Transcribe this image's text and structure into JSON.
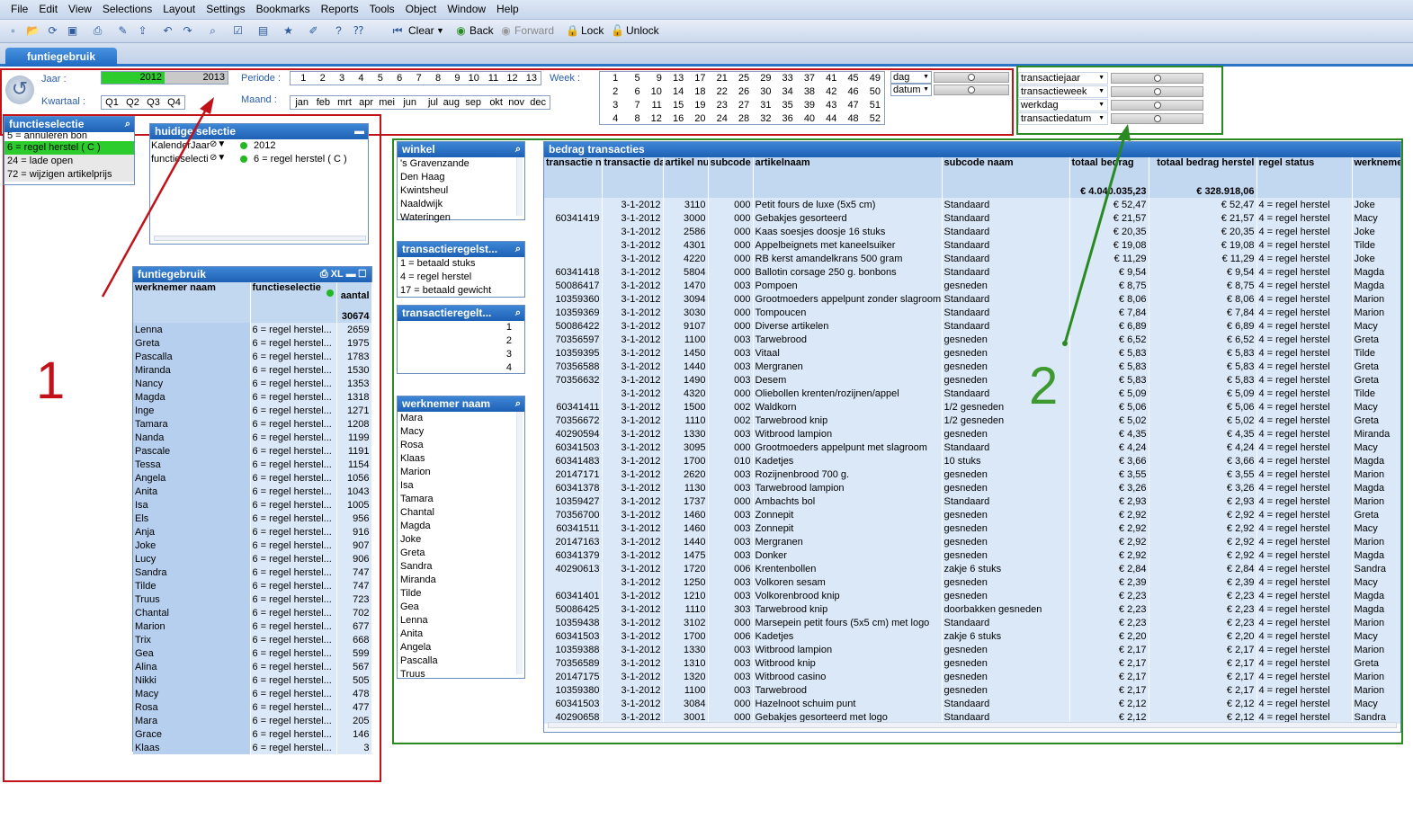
{
  "menu": [
    "File",
    "Edit",
    "View",
    "Selections",
    "Layout",
    "Settings",
    "Bookmarks",
    "Reports",
    "Tools",
    "Object",
    "Window",
    "Help"
  ],
  "toolbar": {
    "clear": "Clear",
    "back": "Back",
    "forward": "Forward",
    "lock": "Lock",
    "unlock": "Unlock"
  },
  "tab": "funtiegebruik",
  "filters": {
    "jaar_label": "Jaar :",
    "jaar": [
      "2012",
      "2013"
    ],
    "kwartaal_label": "Kwartaal :",
    "kwartaal": [
      "Q1",
      "Q2",
      "Q3",
      "Q4"
    ],
    "periode_label": "Periode :",
    "periode": [
      "1",
      "2",
      "3",
      "4",
      "5",
      "6",
      "7",
      "8",
      "9",
      "10",
      "11",
      "12",
      "13"
    ],
    "maand_label": "Maand :",
    "maand": [
      "jan",
      "feb",
      "mrt",
      "apr",
      "mei",
      "jun",
      "jul",
      "aug",
      "sep",
      "okt",
      "nov",
      "dec"
    ],
    "week_label": "Week :",
    "weeks": [
      "1",
      "5",
      "9",
      "13",
      "17",
      "21",
      "25",
      "29",
      "33",
      "37",
      "41",
      "45",
      "49",
      "2",
      "6",
      "10",
      "14",
      "18",
      "22",
      "26",
      "30",
      "34",
      "38",
      "42",
      "46",
      "50",
      "3",
      "7",
      "11",
      "15",
      "19",
      "23",
      "27",
      "31",
      "35",
      "39",
      "43",
      "47",
      "51",
      "4",
      "8",
      "12",
      "16",
      "20",
      "24",
      "28",
      "32",
      "36",
      "40",
      "44",
      "48",
      "52"
    ],
    "dag": "dag",
    "datum": "datum",
    "right": [
      "transactiejaar",
      "transactieweek",
      "werkdag",
      "transactiedatum"
    ]
  },
  "functieselectie": {
    "title": "functieselectie",
    "items": [
      "5 = annuleren bon",
      "6 = regel herstel ( C )",
      "24 = lade open",
      "72 = wijzigen artikelprijs"
    ]
  },
  "huidige": {
    "title": "huidige selectie",
    "rows": [
      {
        "field": "KalenderJaar",
        "value": "2012"
      },
      {
        "field": "functieselectie",
        "value": "6 = regel herstel ( C )"
      }
    ]
  },
  "funtiegebruik": {
    "title": "funtiegebruik",
    "h1": "werknemer naam",
    "h2": "functieselectie",
    "h3": "aantal",
    "total": "30674",
    "rows": [
      [
        "Lenna",
        "2659"
      ],
      [
        "Greta",
        "1975"
      ],
      [
        "Pascalla",
        "1783"
      ],
      [
        "Miranda",
        "1530"
      ],
      [
        "Nancy",
        "1353"
      ],
      [
        "Magda",
        "1318"
      ],
      [
        "Inge",
        "1271"
      ],
      [
        "Tamara",
        "1208"
      ],
      [
        "Nanda",
        "1199"
      ],
      [
        "Pascale",
        "1191"
      ],
      [
        "Tessa",
        "1154"
      ],
      [
        "Angela",
        "1056"
      ],
      [
        "Anita",
        "1043"
      ],
      [
        "Isa",
        "1005"
      ],
      [
        "Els",
        "956"
      ],
      [
        "Anja",
        "916"
      ],
      [
        "Joke",
        "907"
      ],
      [
        "Lucy",
        "906"
      ],
      [
        "Sandra",
        "747"
      ],
      [
        "Tilde",
        "747"
      ],
      [
        "Truus",
        "723"
      ],
      [
        "Chantal",
        "702"
      ],
      [
        "Marion",
        "677"
      ],
      [
        "Trix",
        "668"
      ],
      [
        "Gea",
        "599"
      ],
      [
        "Alina",
        "567"
      ],
      [
        "Nikki",
        "505"
      ],
      [
        "Macy",
        "478"
      ],
      [
        "Rosa",
        "477"
      ],
      [
        "Mara",
        "205"
      ],
      [
        "Grace",
        "146"
      ],
      [
        "Klaas",
        "3"
      ]
    ],
    "func": "6 = regel herstel..."
  },
  "winkel": {
    "title": "winkel",
    "items": [
      "'s Gravenzande",
      "Den Haag",
      "Kwintsheul",
      "Naaldwijk",
      "Wateringen"
    ]
  },
  "tr1": {
    "title": "transactieregelst...",
    "items": [
      "1 = betaald stuks",
      "4 = regel herstel",
      "17 = betaald gewicht"
    ]
  },
  "tr2": {
    "title": "transactieregelt...",
    "items": [
      "1",
      "2",
      "3",
      "4"
    ]
  },
  "werknemer": {
    "title": "werknemer naam",
    "items": [
      "Mara",
      "Macy",
      "Rosa",
      "Klaas",
      "Marion",
      "Isa",
      "Tamara",
      "Chantal",
      "Magda",
      "Joke",
      "Greta",
      "Sandra",
      "Miranda",
      "Tilde",
      "Gea",
      "Lenna",
      "Anita",
      "Angela",
      "Pascalla",
      "Truus"
    ]
  },
  "bedrag": {
    "title": "bedrag transacties",
    "headers": [
      "transactie nummer",
      "transactie datum",
      "artikel nummer",
      "subcode nummer",
      "artikelnaam",
      "subcode naam",
      "totaal bedrag",
      "totaal bedrag herstel",
      "regel status",
      "werknemer"
    ],
    "total1": "€ 4.040.035,23",
    "total2": "€ 328.918,06",
    "rows": [
      [
        "",
        "3-1-2012",
        "3110",
        "000",
        "Petit fours de luxe  (5x5 cm)",
        "Standaard",
        "€ 52,47",
        "€ 52,47",
        "4 = regel herstel",
        "Joke"
      ],
      [
        "60341419",
        "3-1-2012",
        "3000",
        "000",
        "Gebakjes gesorteerd",
        "Standaard",
        "€ 21,57",
        "€ 21,57",
        "4 = regel herstel",
        "Macy"
      ],
      [
        "",
        "3-1-2012",
        "2586",
        "000",
        "Kaas soesjes doosje 16 stuks",
        "Standaard",
        "€ 20,35",
        "€ 20,35",
        "4 = regel herstel",
        "Joke"
      ],
      [
        "",
        "3-1-2012",
        "4301",
        "000",
        "Appelbeignets met kaneelsuiker",
        "Standaard",
        "€ 19,08",
        "€ 19,08",
        "4 = regel herstel",
        "Tilde"
      ],
      [
        "",
        "3-1-2012",
        "4220",
        "000",
        "RB kerst amandelkrans 500 gram",
        "Standaard",
        "€ 11,29",
        "€ 11,29",
        "4 = regel herstel",
        "Joke"
      ],
      [
        "60341418",
        "3-1-2012",
        "5804",
        "000",
        "Ballotin corsage 250 g. bonbons",
        "Standaard",
        "€ 9,54",
        "€ 9,54",
        "4 = regel herstel",
        "Magda"
      ],
      [
        "50086417",
        "3-1-2012",
        "1470",
        "003",
        "Pompoen",
        "gesneden",
        "€ 8,75",
        "€ 8,75",
        "4 = regel herstel",
        "Magda"
      ],
      [
        "10359360",
        "3-1-2012",
        "3094",
        "000",
        "Grootmoeders appelpunt zonder slagroom",
        "Standaard",
        "€ 8,06",
        "€ 8,06",
        "4 = regel herstel",
        "Marion"
      ],
      [
        "10359369",
        "3-1-2012",
        "3030",
        "000",
        "Tompoucen",
        "Standaard",
        "€ 7,84",
        "€ 7,84",
        "4 = regel herstel",
        "Marion"
      ],
      [
        "50086422",
        "3-1-2012",
        "9107",
        "000",
        "Diverse artikelen",
        "Standaard",
        "€ 6,89",
        "€ 6,89",
        "4 = regel herstel",
        "Macy"
      ],
      [
        "70356597",
        "3-1-2012",
        "1100",
        "003",
        "Tarwebrood",
        "gesneden",
        "€ 6,52",
        "€ 6,52",
        "4 = regel herstel",
        "Greta"
      ],
      [
        "10359395",
        "3-1-2012",
        "1450",
        "003",
        "Vitaal",
        "gesneden",
        "€ 5,83",
        "€ 5,83",
        "4 = regel herstel",
        "Tilde"
      ],
      [
        "70356588",
        "3-1-2012",
        "1440",
        "003",
        "Mergranen",
        "gesneden",
        "€ 5,83",
        "€ 5,83",
        "4 = regel herstel",
        "Greta"
      ],
      [
        "70356632",
        "3-1-2012",
        "1490",
        "003",
        "Desem",
        "gesneden",
        "€ 5,83",
        "€ 5,83",
        "4 = regel herstel",
        "Greta"
      ],
      [
        "",
        "3-1-2012",
        "4320",
        "000",
        "Oliebollen krenten/rozijnen/appel",
        "Standaard",
        "€ 5,09",
        "€ 5,09",
        "4 = regel herstel",
        "Tilde"
      ],
      [
        "60341411",
        "3-1-2012",
        "1500",
        "002",
        "Waldkorn",
        "1/2 gesneden",
        "€ 5,06",
        "€ 5,06",
        "4 = regel herstel",
        "Macy"
      ],
      [
        "70356672",
        "3-1-2012",
        "1110",
        "002",
        "Tarwebrood knip",
        "1/2 gesneden",
        "€ 5,02",
        "€ 5,02",
        "4 = regel herstel",
        "Greta"
      ],
      [
        "40290594",
        "3-1-2012",
        "1330",
        "003",
        "Witbrood lampion",
        "gesneden",
        "€ 4,35",
        "€ 4,35",
        "4 = regel herstel",
        "Miranda"
      ],
      [
        "60341503",
        "3-1-2012",
        "3095",
        "000",
        "Grootmoeders appelpunt met slagroom",
        "Standaard",
        "€ 4,24",
        "€ 4,24",
        "4 = regel herstel",
        "Macy"
      ],
      [
        "60341483",
        "3-1-2012",
        "1700",
        "010",
        "Kadetjes",
        "10 stuks",
        "€ 3,66",
        "€ 3,66",
        "4 = regel herstel",
        "Magda"
      ],
      [
        "20147171",
        "3-1-2012",
        "2620",
        "003",
        "Rozijnenbrood 700 g.",
        "gesneden",
        "€ 3,55",
        "€ 3,55",
        "4 = regel herstel",
        "Marion"
      ],
      [
        "60341378",
        "3-1-2012",
        "1130",
        "003",
        "Tarwebrood lampion",
        "gesneden",
        "€ 3,26",
        "€ 3,26",
        "4 = regel herstel",
        "Magda"
      ],
      [
        "10359427",
        "3-1-2012",
        "1737",
        "000",
        "Ambachts bol",
        "Standaard",
        "€ 2,93",
        "€ 2,93",
        "4 = regel herstel",
        "Marion"
      ],
      [
        "70356700",
        "3-1-2012",
        "1460",
        "003",
        "Zonnepit",
        "gesneden",
        "€ 2,92",
        "€ 2,92",
        "4 = regel herstel",
        "Greta"
      ],
      [
        "60341511",
        "3-1-2012",
        "1460",
        "003",
        "Zonnepit",
        "gesneden",
        "€ 2,92",
        "€ 2,92",
        "4 = regel herstel",
        "Macy"
      ],
      [
        "20147163",
        "3-1-2012",
        "1440",
        "003",
        "Mergranen",
        "gesneden",
        "€ 2,92",
        "€ 2,92",
        "4 = regel herstel",
        "Marion"
      ],
      [
        "60341379",
        "3-1-2012",
        "1475",
        "003",
        "Donker",
        "gesneden",
        "€ 2,92",
        "€ 2,92",
        "4 = regel herstel",
        "Magda"
      ],
      [
        "40290613",
        "3-1-2012",
        "1720",
        "006",
        "Krentenbollen",
        "zakje 6 stuks",
        "€ 2,84",
        "€ 2,84",
        "4 = regel herstel",
        "Sandra"
      ],
      [
        "",
        "3-1-2012",
        "1250",
        "003",
        "Volkoren sesam",
        "gesneden",
        "€ 2,39",
        "€ 2,39",
        "4 = regel herstel",
        "Macy"
      ],
      [
        "60341401",
        "3-1-2012",
        "1210",
        "003",
        "Volkorenbrood knip",
        "gesneden",
        "€ 2,23",
        "€ 2,23",
        "4 = regel herstel",
        "Magda"
      ],
      [
        "50086425",
        "3-1-2012",
        "1110",
        "303",
        "Tarwebrood knip",
        "doorbakken gesneden",
        "€ 2,23",
        "€ 2,23",
        "4 = regel herstel",
        "Magda"
      ],
      [
        "10359438",
        "3-1-2012",
        "3102",
        "000",
        "Marsepein petit fours (5x5 cm) met logo",
        "Standaard",
        "€ 2,23",
        "€ 2,23",
        "4 = regel herstel",
        "Marion"
      ],
      [
        "60341503",
        "3-1-2012",
        "1700",
        "006",
        "Kadetjes",
        "zakje 6 stuks",
        "€ 2,20",
        "€ 2,20",
        "4 = regel herstel",
        "Macy"
      ],
      [
        "10359388",
        "3-1-2012",
        "1330",
        "003",
        "Witbrood lampion",
        "gesneden",
        "€ 2,17",
        "€ 2,17",
        "4 = regel herstel",
        "Marion"
      ],
      [
        "70356589",
        "3-1-2012",
        "1310",
        "003",
        "Witbrood knip",
        "gesneden",
        "€ 2,17",
        "€ 2,17",
        "4 = regel herstel",
        "Greta"
      ],
      [
        "20147175",
        "3-1-2012",
        "1320",
        "003",
        "Witbrood casino",
        "gesneden",
        "€ 2,17",
        "€ 2,17",
        "4 = regel herstel",
        "Marion"
      ],
      [
        "10359380",
        "3-1-2012",
        "1100",
        "003",
        "Tarwebrood",
        "gesneden",
        "€ 2,17",
        "€ 2,17",
        "4 = regel herstel",
        "Marion"
      ],
      [
        "60341503",
        "3-1-2012",
        "3084",
        "000",
        "Hazelnoot schuim punt",
        "Standaard",
        "€ 2,12",
        "€ 2,12",
        "4 = regel herstel",
        "Macy"
      ],
      [
        "40290658",
        "3-1-2012",
        "3001",
        "000",
        "Gebakjes gesorteerd met logo",
        "Standaard",
        "€ 2,12",
        "€ 2,12",
        "4 = regel herstel",
        "Sandra"
      ]
    ]
  },
  "annotations": {
    "one": "1",
    "two": "2"
  }
}
